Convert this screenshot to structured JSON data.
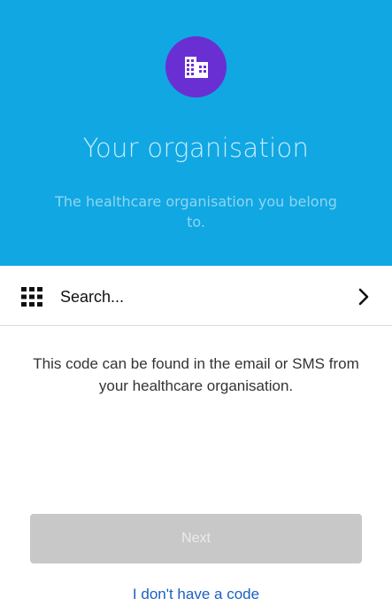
{
  "header": {
    "title": "Your organisation",
    "subtitle": "The healthcare organisation you belong to.",
    "background_color": "#10a7e3",
    "badge_color": "#6a2fd3",
    "badge_icon": "building-icon"
  },
  "search": {
    "label": "Search...",
    "leading_icon": "grid-icon",
    "trailing_icon": "chevron-right-icon"
  },
  "info": {
    "text": "This code can be found in the email or SMS from your healthcare organisation."
  },
  "actions": {
    "next_label": "Next",
    "next_enabled": false,
    "no_code_label": "I don't have a code",
    "link_color": "#1c5fbf"
  }
}
